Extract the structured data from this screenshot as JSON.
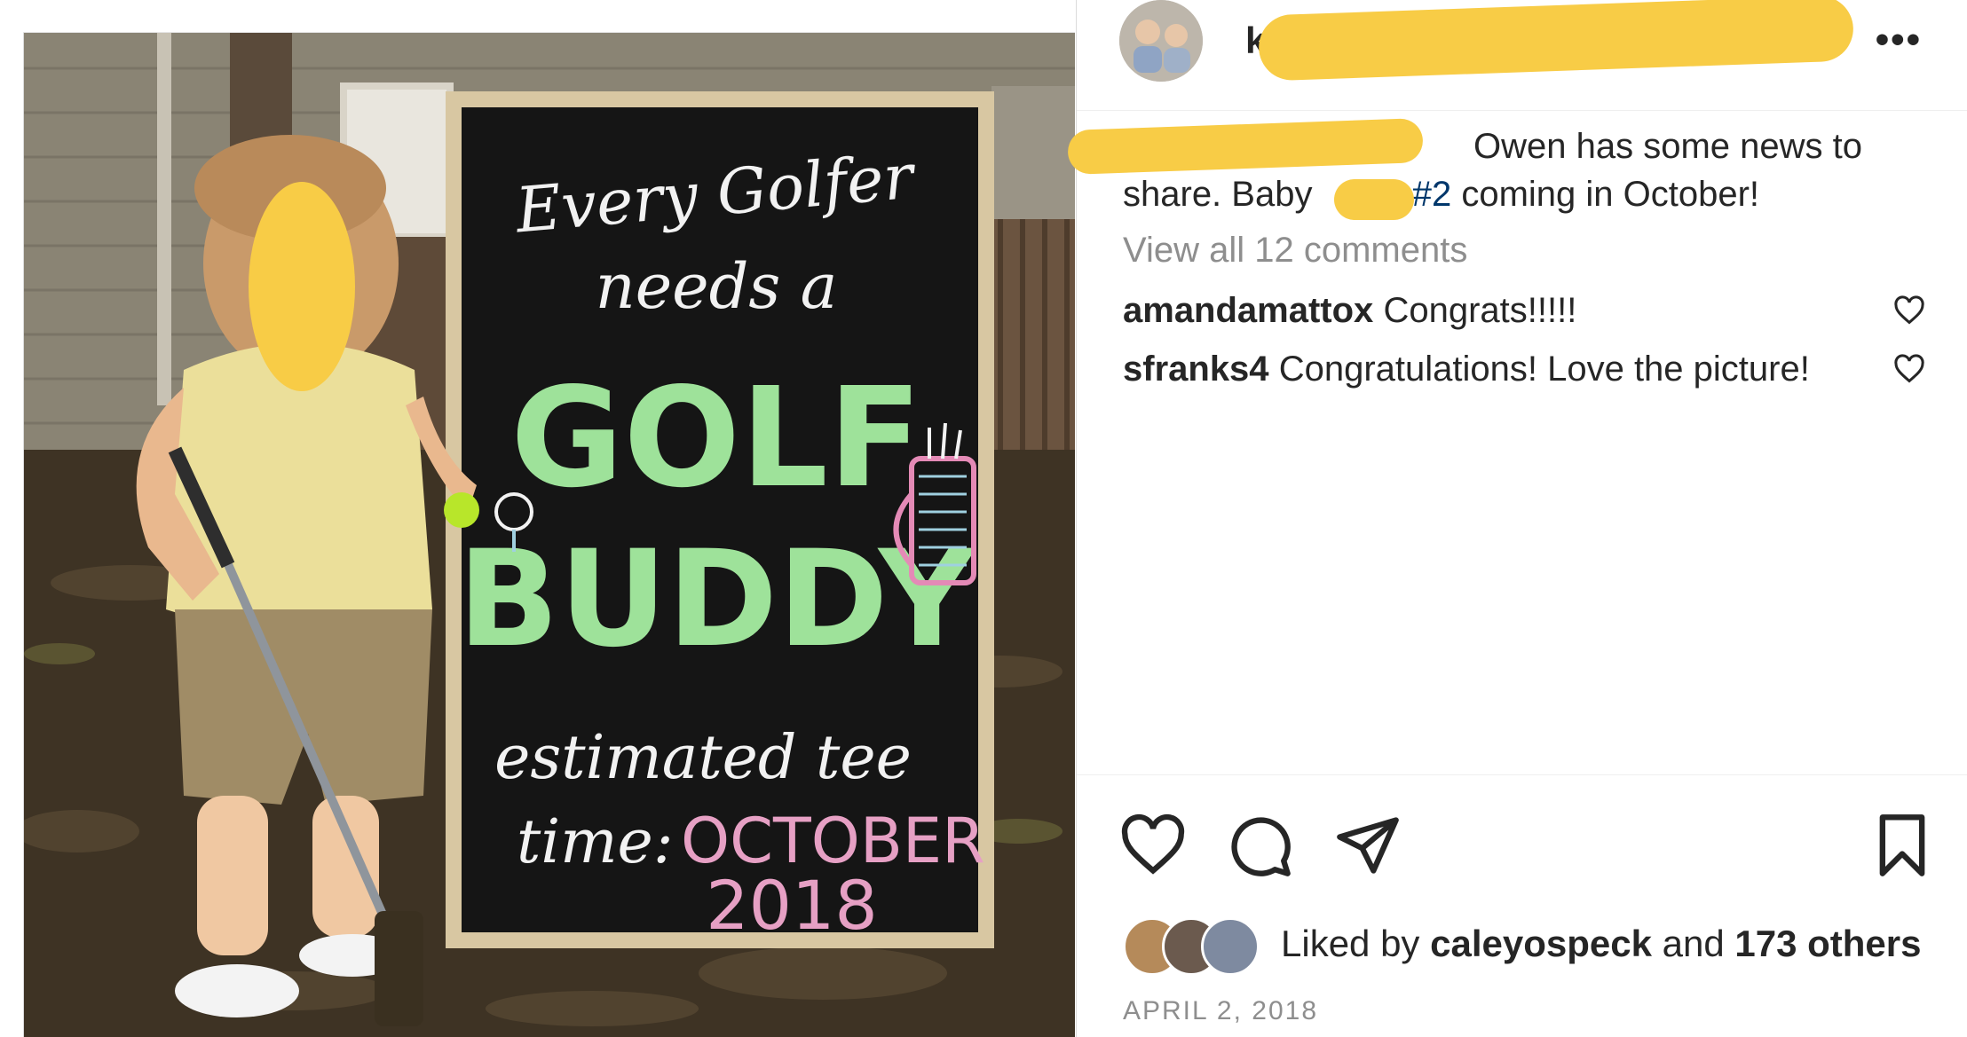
{
  "post": {
    "username_visible": "k",
    "more_label": "•••",
    "caption": {
      "text": "Owen has some news to",
      "line2_start": "share. Baby",
      "hashtag": "#2",
      "line2_end": "coming in October!"
    },
    "view_all_comments": "View all 12 comments",
    "comments": [
      {
        "user": "amandamattox",
        "text": "Congrats!!!!!"
      },
      {
        "user": "sfranks4",
        "text": "Congratulations! Love the picture!"
      }
    ],
    "likes": {
      "prefix": "Liked by",
      "user": "caleyospeck",
      "middle": "and",
      "others": "173 others"
    },
    "date": "APRIL 2, 2018",
    "icons": [
      "heart-icon",
      "comment-icon",
      "share-icon",
      "bookmark-icon",
      "more-icon"
    ],
    "redaction_color": "#f8cc46"
  },
  "photo": {
    "sign": {
      "line1": "Every Golfer",
      "line2": "needs a",
      "line3": "GOLF",
      "line4": "BUDDY",
      "line5": "estimated tee",
      "line6_label": "time:",
      "line6_month": "OCTOBER",
      "line7": "2018"
    }
  }
}
